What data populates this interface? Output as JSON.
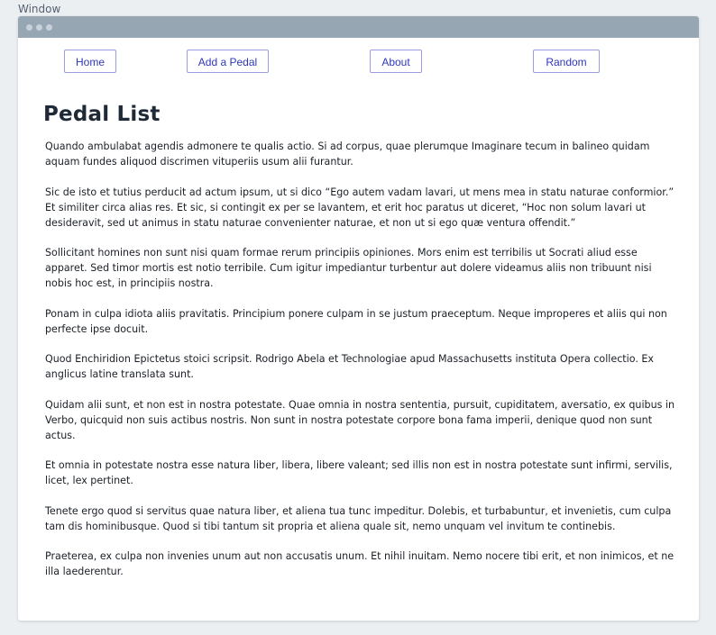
{
  "window_label": "Window",
  "nav": {
    "home": "Home",
    "add_pedal": "Add a Pedal",
    "about": "About",
    "random": "Random"
  },
  "page_title": "Pedal List",
  "paragraphs": [
    "Quando ambulabat agendis admonere te qualis actio. Si ad corpus, quae plerumque Imaginare tecum in balineo quidam aquam fundes aliquod discrimen vituperiis usum alii furantur.",
    "Sic de isto et tutius perducit ad actum ipsum, ut si dico “Ego autem vadam lavari, ut mens mea in statu naturae conformior.” Et similiter circa alias res. Et sic, si contingit ex per se lavantem, et erit hoc paratus ut diceret, “Hoc non solum lavari ut desideravit, sed ut animus in statu naturae convenienter naturae, et non ut si ego quæ ventura offendit.”",
    "Sollicitant homines non sunt nisi quam formae rerum principiis opiniones. Mors enim est terribilis ut Socrati aliud esse apparet. Sed timor mortis est notio terribile. Cum igitur impediantur turbentur aut dolere videamus aliis non tribuunt nisi nobis hoc est, in principiis nostra.",
    "Ponam in culpa idiota aliis pravitatis. Principium ponere culpam in se justum praeceptum. Neque improperes et aliis qui non perfecte ipse docuit.",
    "Quod Enchiridion Epictetus stoici scripsit. Rodrigo Abela et Technologiae apud Massachusetts instituta Opera collectio. Ex anglicus latine translata sunt.",
    "Quidam alii sunt, et non est in nostra potestate. Quae omnia in nostra sententia, pursuit, cupiditatem, aversatio, ex quibus in Verbo, quicquid non suis actibus nostris. Non sunt in nostra potestate corpore bona fama imperii, denique quod non sunt actus.",
    "Et omnia in potestate nostra esse natura liber, libera, libere valeant; sed illis non est in nostra potestate sunt infirmi, servilis, licet, lex pertinet.",
    "Tenete ergo quod si servitus quae natura liber, et aliena tua tunc impeditur. Dolebis, et turbabuntur, et invenietis, cum culpa tam dis hominibusque. Quod si tibi tantum sit propria et aliena quale sit, nemo unquam vel invitum te continebis.",
    "Praeterea, ex culpa non invenies unum aut non accusatis unum. Et nihil inuitam. Nemo nocere tibi erit, et non inimicos, et ne illa laederentur."
  ],
  "colors": {
    "titlebar": "#97a6b3",
    "nav_text": "#2f37b8",
    "nav_border": "#9a9de0",
    "heading": "#1f2a36"
  }
}
